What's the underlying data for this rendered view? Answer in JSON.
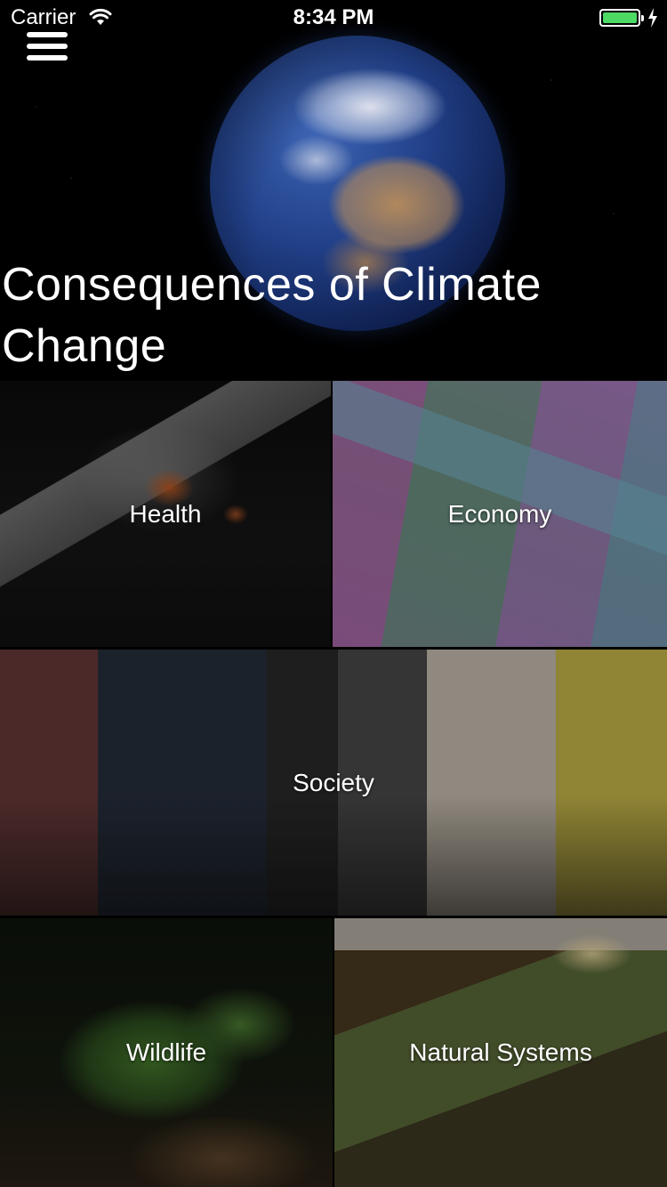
{
  "status_bar": {
    "carrier": "Carrier",
    "time": "8:34 PM",
    "battery_color": "#4cd964"
  },
  "header": {
    "menu_icon": "hamburger-menu-icon",
    "title": "Consequences of Climate Change"
  },
  "tiles": [
    {
      "id": "health",
      "label": "Health"
    },
    {
      "id": "economy",
      "label": "Economy"
    },
    {
      "id": "society",
      "label": "Society"
    },
    {
      "id": "wildlife",
      "label": "Wildlife"
    },
    {
      "id": "natural-systems",
      "label": "Natural Systems"
    }
  ]
}
